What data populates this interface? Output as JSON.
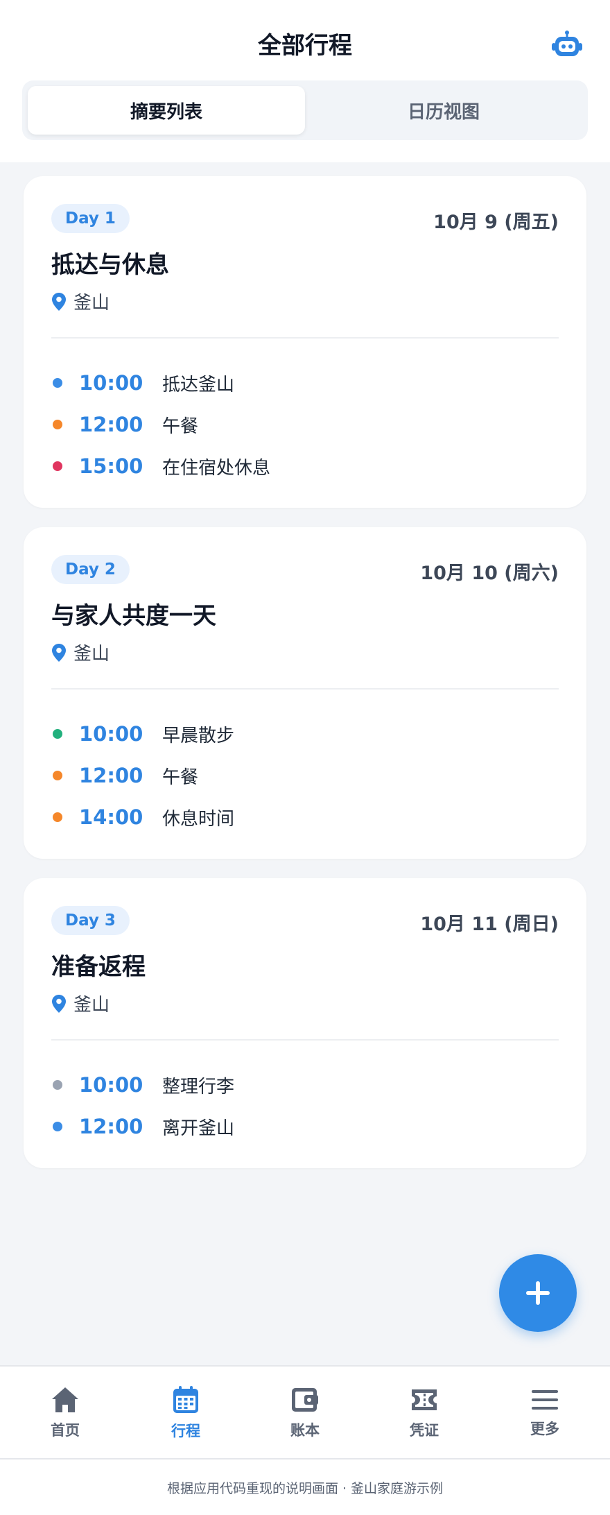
{
  "header": {
    "title": "全部行程"
  },
  "tabs": [
    {
      "label": "摘要列表",
      "active": true
    },
    {
      "label": "日历视图",
      "active": false
    }
  ],
  "days": [
    {
      "badge": "Day 1",
      "date": "10月 9 (周五)",
      "title": "抵达与休息",
      "location": "釜山",
      "events": [
        {
          "time": "10:00",
          "name": "抵达釜山",
          "color": "#3b8de6"
        },
        {
          "time": "12:00",
          "name": "午餐",
          "color": "#f5872a"
        },
        {
          "time": "15:00",
          "name": "在住宿处休息",
          "color": "#e0355f"
        }
      ]
    },
    {
      "badge": "Day 2",
      "date": "10月 10 (周六)",
      "title": "与家人共度一天",
      "location": "釜山",
      "events": [
        {
          "time": "10:00",
          "name": "早晨散步",
          "color": "#22b07d"
        },
        {
          "time": "12:00",
          "name": "午餐",
          "color": "#f5872a"
        },
        {
          "time": "14:00",
          "name": "休息时间",
          "color": "#f5872a"
        }
      ]
    },
    {
      "badge": "Day 3",
      "date": "10月 11 (周日)",
      "title": "准备返程",
      "location": "釜山",
      "events": [
        {
          "time": "10:00",
          "name": "整理行李",
          "color": "#9aa3b2"
        },
        {
          "time": "12:00",
          "name": "离开釜山",
          "color": "#3b8de6"
        }
      ]
    }
  ],
  "nav": [
    {
      "label": "首页",
      "icon": "home-icon",
      "active": false
    },
    {
      "label": "行程",
      "icon": "calendar-icon",
      "active": true
    },
    {
      "label": "账本",
      "icon": "wallet-icon",
      "active": false
    },
    {
      "label": "凭证",
      "icon": "ticket-icon",
      "active": false
    },
    {
      "label": "更多",
      "icon": "menu-icon",
      "active": false
    }
  ],
  "footer": {
    "text": "根据应用代码重现的说明画面 · 釜山家庭游示例"
  },
  "colors": {
    "accent": "#2f84e0",
    "nav_inactive": "#5b6474"
  }
}
